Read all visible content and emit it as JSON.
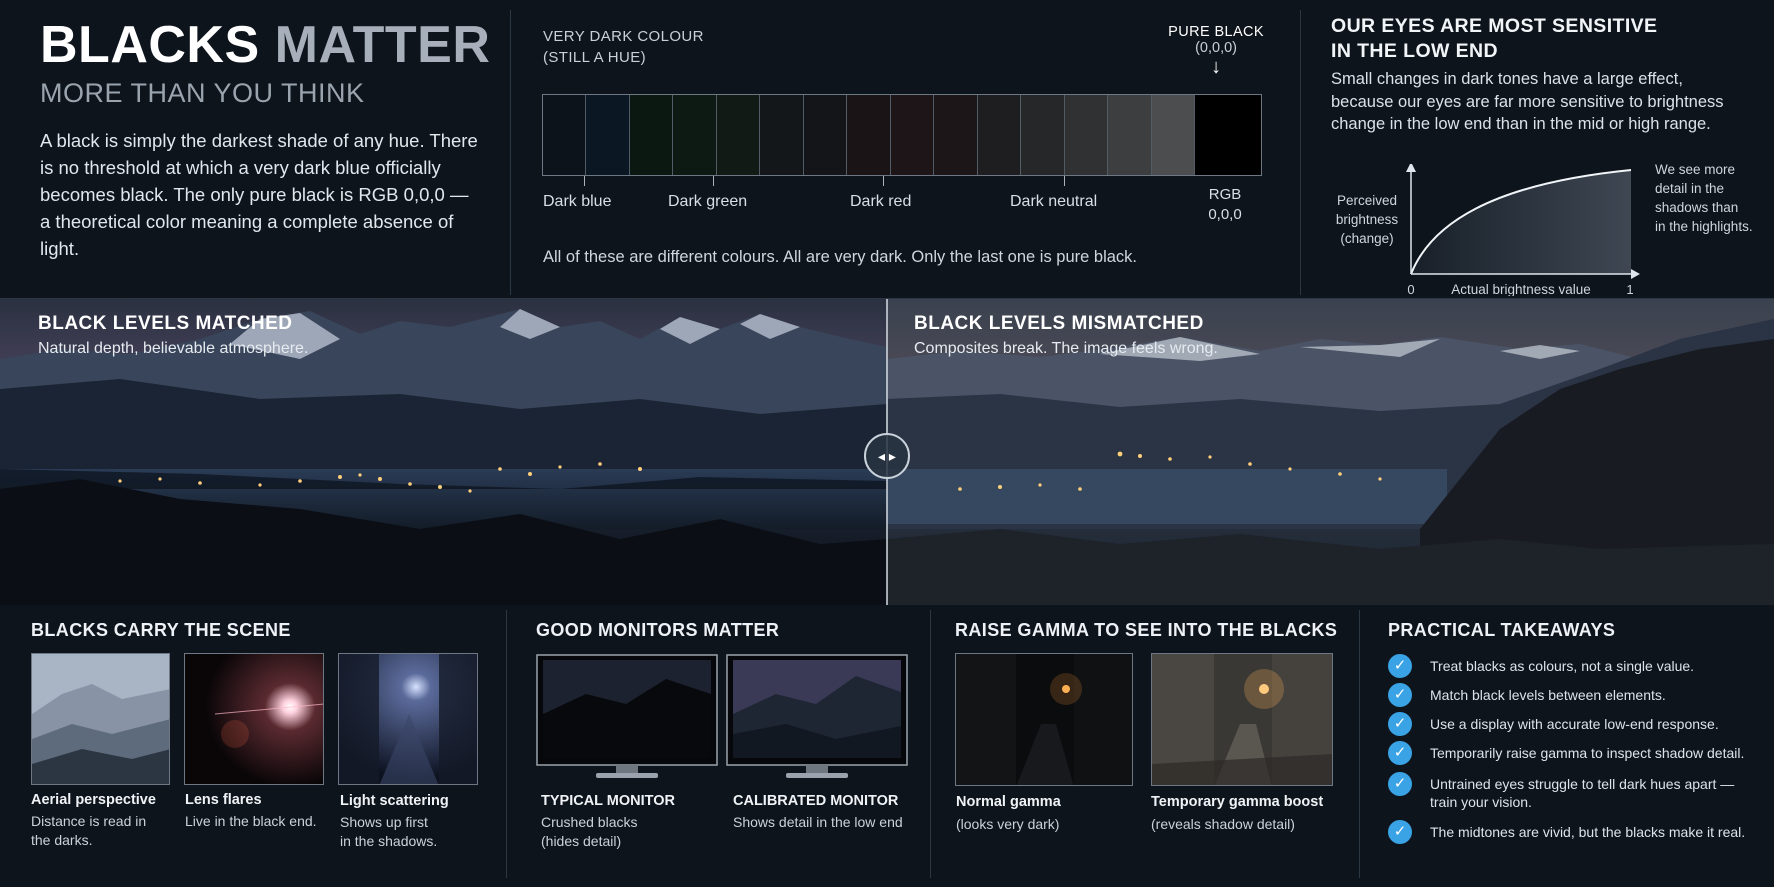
{
  "header": {
    "title_word1": "BLACKS",
    "title_word2": "MATTER",
    "subtitle": "MORE THAN YOU THINK",
    "intro": "A black is simply the darkest shade of any hue. There is no threshold at which a very dark blue officially becomes black. The only pure black is RGB 0,0,0 — a theoretical color meaning a complete absence of light."
  },
  "swatches": {
    "caption_line1": "VERY DARK COLOUR",
    "caption_line2": "(STILL A HUE)",
    "pure_black_line1": "PURE BLACK",
    "pure_black_line2": "(0,0,0)",
    "arrow": "↓",
    "colors": [
      "#0d131b",
      "#0b1722",
      "#0b1812",
      "#0d1a14",
      "#111a15",
      "#14171a",
      "#141518",
      "#1a1416",
      "#1d1517",
      "#1c1618",
      "#1e1e20",
      "#262729",
      "#303133",
      "#3d3e40",
      "#4c4d4f",
      "#000000"
    ],
    "labels": [
      "Dark blue",
      "Dark green",
      "Dark red",
      "Dark neutral"
    ],
    "rgb_line1": "RGB",
    "rgb_line2": "0,0,0",
    "note": "All of these are different colours. All are very dark. Only the last one is pure black."
  },
  "eyes": {
    "title_line1": "OUR EYES ARE MOST SENSITIVE",
    "title_line2": "IN THE LOW END",
    "text": "Small changes in dark tones have a large effect, because our eyes are far more sensitive to brightness change in the low end than in the mid or high range.",
    "ylabel_line1": "Perceived",
    "ylabel_line2": "brightness",
    "ylabel_line3": "(change)",
    "xlabel": "Actual brightness value",
    "x0": "0",
    "x1": "1",
    "note_line1": "We see more",
    "note_line2": "detail in the",
    "note_line3": "shadows than",
    "note_line4": "in the highlights."
  },
  "photo": {
    "left_title": "BLACK LEVELS MATCHED",
    "left_sub": "Natural depth, believable atmosphere.",
    "right_title": "BLACK LEVELS MISMATCHED",
    "right_sub": "Composites break. The image feels wrong.",
    "handle_glyph": "◂ ▸"
  },
  "scene": {
    "title": "BLACKS CARRY THE SCENE",
    "items": [
      {
        "title": "Aerial perspective",
        "line1": "Distance is read in",
        "line2": "the darks."
      },
      {
        "title": "Lens flares",
        "line1": "Live in the black end.",
        "line2": ""
      },
      {
        "title": "Light scattering",
        "line1": "Shows up first",
        "line2": "in the shadows."
      }
    ]
  },
  "monitors": {
    "title": "GOOD MONITORS MATTER",
    "typical_title": "TYPICAL MONITOR",
    "typical_line1": "Crushed blacks",
    "typical_line2": "(hides detail)",
    "calibrated_title": "CALIBRATED MONITOR",
    "calibrated_line1": "Shows detail in the low end"
  },
  "gamma": {
    "title": "RAISE GAMMA TO SEE INTO THE BLACKS",
    "normal_title": "Normal gamma",
    "normal_sub": "(looks very dark)",
    "boost_title": "Temporary gamma boost",
    "boost_sub": "(reveals shadow detail)"
  },
  "takeaways": {
    "title": "PRACTICAL TAKEAWAYS",
    "check_glyph": "✓",
    "items": [
      "Treat blacks as colours, not a single value.",
      "Match black levels between elements.",
      "Use a display with accurate low-end response.",
      "Temporarily raise gamma to inspect shadow detail.",
      "Untrained eyes struggle to tell dark hues apart — train your vision.",
      "The midtones are vivid, but the blacks make it real."
    ]
  }
}
